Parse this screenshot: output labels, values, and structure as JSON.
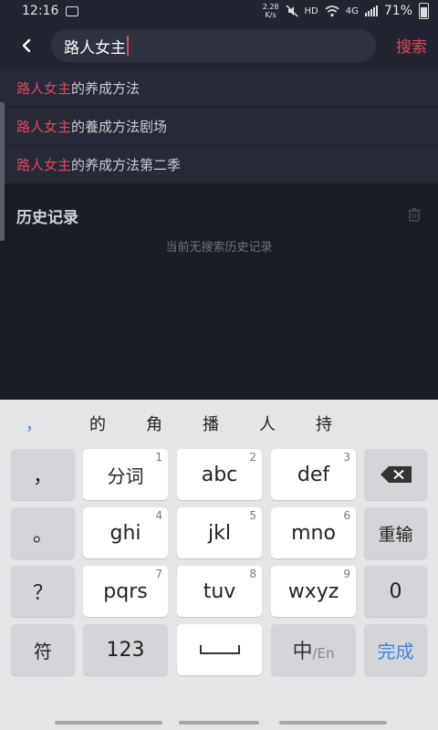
{
  "status_bar": {
    "time": "12:16",
    "net_speed_value": "2.28",
    "net_speed_unit": "K/s",
    "hd_label": "HD",
    "net_type": "4G",
    "battery_percent": "71%"
  },
  "header": {
    "query": "路人女主",
    "search_label": "搜索"
  },
  "suggestions": [
    {
      "highlight": "路人女主",
      "rest": "的养成方法"
    },
    {
      "highlight": "路人女主",
      "rest": "的養成方法剧场"
    },
    {
      "highlight": "路人女主",
      "rest": "的养成方法第二季"
    }
  ],
  "history": {
    "title": "历史记录",
    "empty_text": "当前无搜索历史记录"
  },
  "keyboard": {
    "candidates": [
      "，",
      "的",
      "角",
      "播",
      "人",
      "持"
    ],
    "rows": [
      {
        "left": "，",
        "keys": [
          {
            "label": "分词",
            "num": "1"
          },
          {
            "label": "abc",
            "num": "2"
          },
          {
            "label": "def",
            "num": "3"
          }
        ],
        "right": "backspace"
      },
      {
        "left": "。",
        "keys": [
          {
            "label": "ghi",
            "num": "4"
          },
          {
            "label": "jkl",
            "num": "5"
          },
          {
            "label": "mno",
            "num": "6"
          }
        ],
        "right": "重输"
      },
      {
        "left": "？",
        "keys": [
          {
            "label": "pqrs",
            "num": "7"
          },
          {
            "label": "tuv",
            "num": "8"
          },
          {
            "label": "wxyz",
            "num": "9"
          }
        ],
        "right": "0"
      }
    ],
    "bottom": {
      "symbols": "符",
      "numbers": "123",
      "zh": "中",
      "slash": "/",
      "en": "En",
      "done": "完成"
    }
  },
  "colors": {
    "accent": "#e0475a",
    "background": "#1b1d25",
    "keyboard": "#e4e5e7",
    "done_blue": "#3e86e0"
  },
  "icons": [
    "back-arrow-icon",
    "trash-icon",
    "backspace-icon",
    "gallery-icon",
    "mute-icon",
    "wifi-icon",
    "signal-icon",
    "battery-icon"
  ]
}
